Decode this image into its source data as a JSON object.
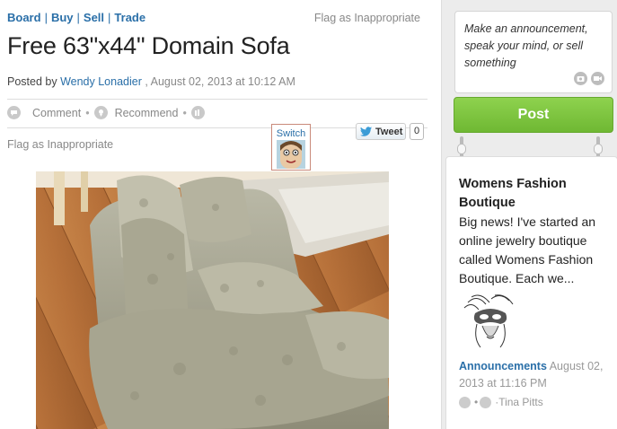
{
  "nav": {
    "items": [
      "Board",
      "Buy",
      "Sell",
      "Trade"
    ],
    "separator": "|"
  },
  "post": {
    "flag_top": "Flag as Inappropriate",
    "title": "Free 63\"x44\" Domain Sofa",
    "posted_by_label": "Posted by",
    "author": "Wendy Lonadier",
    "date": ", August 02, 2013 at 10:12 AM",
    "actions": {
      "comment": "Comment",
      "recommend": "Recommend",
      "dot": "•"
    },
    "flag_bottom": "Flag as Inappropriate",
    "switch_label": "Switch",
    "tweet_label": "Tweet",
    "tweet_count": "0"
  },
  "sidebar": {
    "announcement_placeholder": "Make an announcement, speak your mind, or sell something",
    "post_button": "Post",
    "card": {
      "title": "Womens Fashion Boutique",
      "body": "Big news!  I've started an online jewelry boutique called Womens Fashion Boutique. Each we...",
      "category": "Announcements",
      "date": " August 02, 2013 at 11:16 PM",
      "author": "·Tina Pitts"
    }
  },
  "colors": {
    "link": "#2a6fa8",
    "post_button": "#7cc441",
    "muted": "#888888"
  }
}
